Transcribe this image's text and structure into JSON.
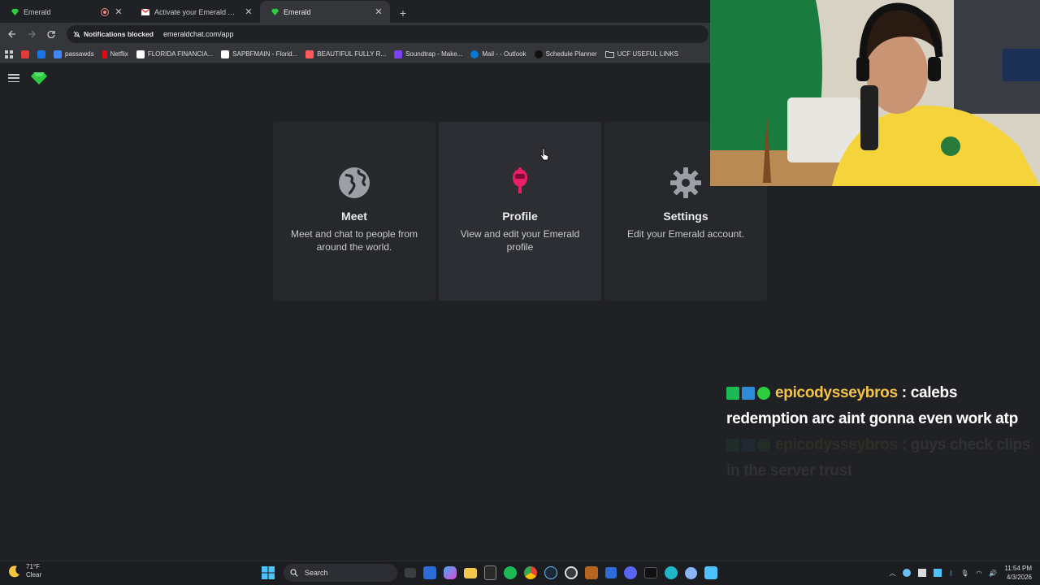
{
  "browser": {
    "tabs": [
      {
        "title": "Emerald",
        "favicon": "emerald-gem-icon",
        "recording": true
      },
      {
        "title": "Activate your Emerald Account",
        "favicon": "gmail-icon"
      },
      {
        "title": "Emerald",
        "favicon": "emerald-gem-icon",
        "active": true
      }
    ],
    "new_tab": "+",
    "address": {
      "notifications_chip": "Notifications blocked",
      "url": "emeraldchat.com/app"
    },
    "bookmarks": [
      {
        "label": "",
        "color": "#e53935",
        "icon": "youtube-icon"
      },
      {
        "label": "",
        "color": "#1a73e8",
        "icon": "app-icon"
      },
      {
        "label": "passawds",
        "color": "#4285f4",
        "icon": "doc-icon"
      },
      {
        "label": "Netflix",
        "color": "#e50914",
        "icon": "netflix-icon"
      },
      {
        "label": "FLORIDA FINANCIA...",
        "color": "#ffffff",
        "icon": "page-icon"
      },
      {
        "label": "SAPBFMAIN - Florid...",
        "color": "#ffffff",
        "icon": "page-icon"
      },
      {
        "label": "BEAUTIFUL FULLY R...",
        "color": "#ff5a5f",
        "icon": "airbnb-icon"
      },
      {
        "label": "Soundtrap - Make...",
        "color": "#7a42f4",
        "icon": "soundtrap-icon"
      },
      {
        "label": "Mail - - Outlook",
        "color": "#0078d4",
        "icon": "outlook-icon"
      },
      {
        "label": "Schedule Planner",
        "color": "#111111",
        "icon": "schedule-icon"
      },
      {
        "label": "UCF USEFUL LINKS",
        "color": "#c8cacd",
        "icon": "folder-icon"
      }
    ]
  },
  "app": {
    "brand_color": "#2ecc40",
    "cards": [
      {
        "title": "Meet",
        "desc": "Meet and chat to people from around the world.",
        "icon": "globe-icon"
      },
      {
        "title": "Profile",
        "desc": "View and edit your Emerald profile",
        "icon": "profile-avatar-icon"
      },
      {
        "title": "Settings",
        "desc": "Edit your Emerald account.",
        "icon": "gear-icon"
      }
    ]
  },
  "chat_overlay": {
    "messages": [
      {
        "user": "epicodysseybros",
        "sep": " : ",
        "text": "calebs redemption arc aint gonna even work atp"
      },
      {
        "user": "epicodysseybros",
        "sep": " : ",
        "text": "guys check clips in the server trust"
      }
    ]
  },
  "taskbar": {
    "weather_temp": "71°F",
    "weather_desc": "Clear",
    "search_label": "Search",
    "time": "11:54 PM",
    "date": "4/3/2026"
  }
}
